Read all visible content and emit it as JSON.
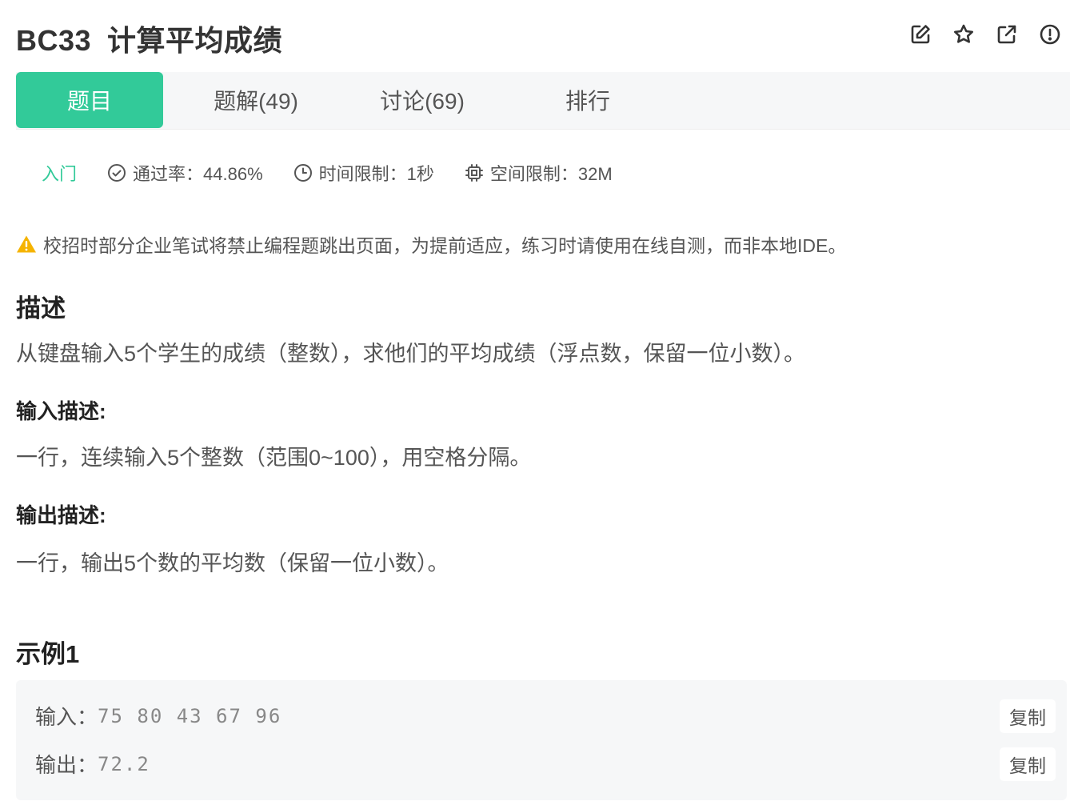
{
  "problem": {
    "id": "BC33",
    "title": "计算平均成绩"
  },
  "toolbar": {
    "icons": [
      "edit-icon",
      "star-icon",
      "external-link-icon",
      "report-icon"
    ]
  },
  "tabs": [
    {
      "label": "题目",
      "active": true
    },
    {
      "label": "题解(49)",
      "active": false
    },
    {
      "label": "讨论(69)",
      "active": false
    },
    {
      "label": "排行",
      "active": false
    }
  ],
  "meta": {
    "level": "入门",
    "pass_rate": "通过率：44.86%",
    "time_limit": "时间限制：1秒",
    "space_limit": "空间限制：32M"
  },
  "warning": "校招时部分企业笔试将禁止编程题跳出页面，为提前适应，练习时请使用在线自测，而非本地IDE。",
  "description": {
    "heading": "描述",
    "text": "从键盘输入5个学生的成绩（整数），求他们的平均成绩（浮点数，保留一位小数）。"
  },
  "input_desc": {
    "heading": "输入描述:",
    "text": "一行，连续输入5个整数（范围0~100），用空格分隔。"
  },
  "output_desc": {
    "heading": "输出描述:",
    "text": "一行，输出5个数的平均数（保留一位小数）。"
  },
  "example": {
    "heading": "示例1",
    "input_label": "输入：",
    "input_value": "75 80 43 67 96",
    "output_label": "输出：",
    "output_value": "72.2",
    "copy_label": "复制"
  },
  "colors": {
    "accent": "#32ca99",
    "warning": "#f5b300"
  }
}
